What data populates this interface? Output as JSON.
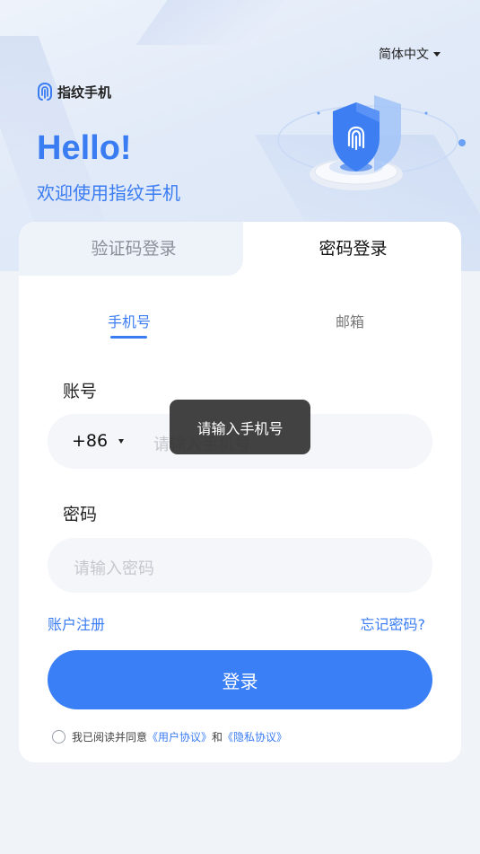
{
  "header": {
    "language": "简体中文",
    "brand_name": "指纹手机",
    "hello": "Hello!",
    "welcome": "欢迎使用指纹手机"
  },
  "login_tabs": {
    "code_login": "验证码登录",
    "password_login": "密码登录"
  },
  "sub_tabs": {
    "phone": "手机号",
    "email": "邮箱"
  },
  "form": {
    "account_label": "账号",
    "country_code": "+86",
    "phone_placeholder": "请输入手机号",
    "password_label": "密码",
    "password_placeholder": "请输入密码",
    "register_link": "账户注册",
    "forgot_link": "忘记密码?",
    "login_button": "登录"
  },
  "agreement": {
    "prefix": "我已阅读并同意",
    "user_agreement": "《用户协议》",
    "conjunction": "和",
    "privacy_agreement": "《隐私协议》"
  },
  "toast": {
    "message": "请输入手机号"
  },
  "colors": {
    "accent": "#3a7ff6",
    "background": "#f0f3f7"
  }
}
